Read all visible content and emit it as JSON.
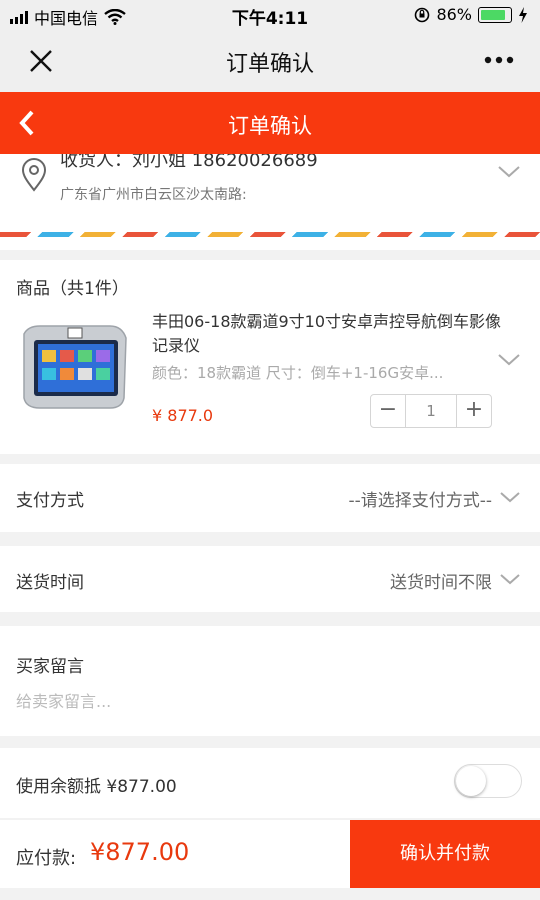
{
  "status_bar": {
    "carrier": "中国电信",
    "time": "下午4:11",
    "battery": "86%",
    "battery_level": 0.86
  },
  "wechat_nav": {
    "title": "订单确认"
  },
  "header": {
    "title": "订单确认"
  },
  "address": {
    "receiver_line": "收货人：刘小姐    18620026689",
    "detail": "广东省广州市白云区沙太南路:"
  },
  "goods": {
    "header": "商品（共1件）",
    "name": "丰田06-18款霸道9寸10寸安卓声控导航倒车影像记录仪",
    "spec": "颜色：18款霸道    尺寸：倒车+1-16G安卓...",
    "price": "¥ 877.0",
    "quantity": "1",
    "minus": "−",
    "plus": "+"
  },
  "payment": {
    "label": "支付方式",
    "value": "--请选择支付方式--"
  },
  "delivery": {
    "label": "送货时间",
    "value": "送货时间不限"
  },
  "message": {
    "label": "买家留言",
    "placeholder": "给卖家留言..."
  },
  "balance": {
    "label": "使用余额抵 ¥877.00",
    "enabled": false
  },
  "footer": {
    "due_label": "应付款:",
    "amount": "¥877.00",
    "confirm_label": "确认并付款"
  },
  "colors": {
    "brand_red": "#f8390f",
    "price_red": "#e8390e"
  }
}
